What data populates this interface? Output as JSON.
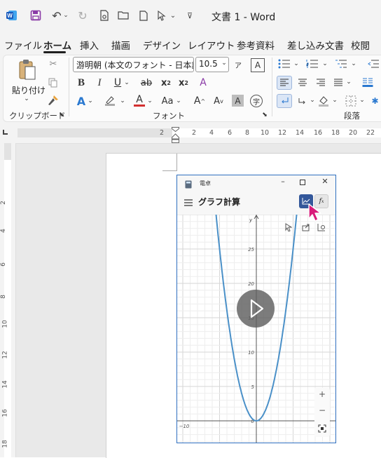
{
  "window": {
    "title": "文書 1  -  Word"
  },
  "menu": {
    "tabs": [
      "ファイル",
      "ホーム",
      "挿入",
      "描画",
      "デザイン",
      "レイアウト",
      "参考資料",
      "差し込み文書",
      "校閲"
    ]
  },
  "ribbon": {
    "paste_label": "貼り付け",
    "font_name": "游明朝 (本文のフォント - 日本語)",
    "font_size": "10.5",
    "groups": {
      "clipboard": "クリップボード",
      "font": "フォント",
      "paragraph": "段落"
    }
  },
  "ruler": {
    "h_numbers": [
      "2",
      "2",
      "4",
      "6",
      "8",
      "10",
      "12",
      "14",
      "16",
      "18",
      "20",
      "22"
    ],
    "v_numbers": [
      "2",
      "4",
      "6",
      "8",
      "10",
      "12",
      "14",
      "16",
      "18"
    ]
  },
  "calculator": {
    "app_name": "電卓",
    "mode_title": "グラフ計算",
    "func_button": "f",
    "y_axis_label": "y",
    "y_ticks": [
      "25",
      "20",
      "15",
      "10",
      "5",
      "0"
    ],
    "x_ticks": [
      "−10",
      "0"
    ],
    "zoom_in": "+",
    "zoom_out": "−"
  },
  "chart_data": {
    "type": "line",
    "title": "",
    "xlabel": "",
    "ylabel": "y",
    "xlim": [
      -11,
      11
    ],
    "ylim": [
      -3,
      30
    ],
    "series": [
      {
        "x": [
          -5.5,
          -5,
          -4,
          -3,
          -2,
          -1,
          0,
          1,
          2,
          3,
          4,
          5,
          5.5
        ],
        "values": [
          30.25,
          25,
          16,
          9,
          4,
          1,
          0,
          1,
          4,
          9,
          16,
          25,
          30.25
        ]
      }
    ]
  }
}
